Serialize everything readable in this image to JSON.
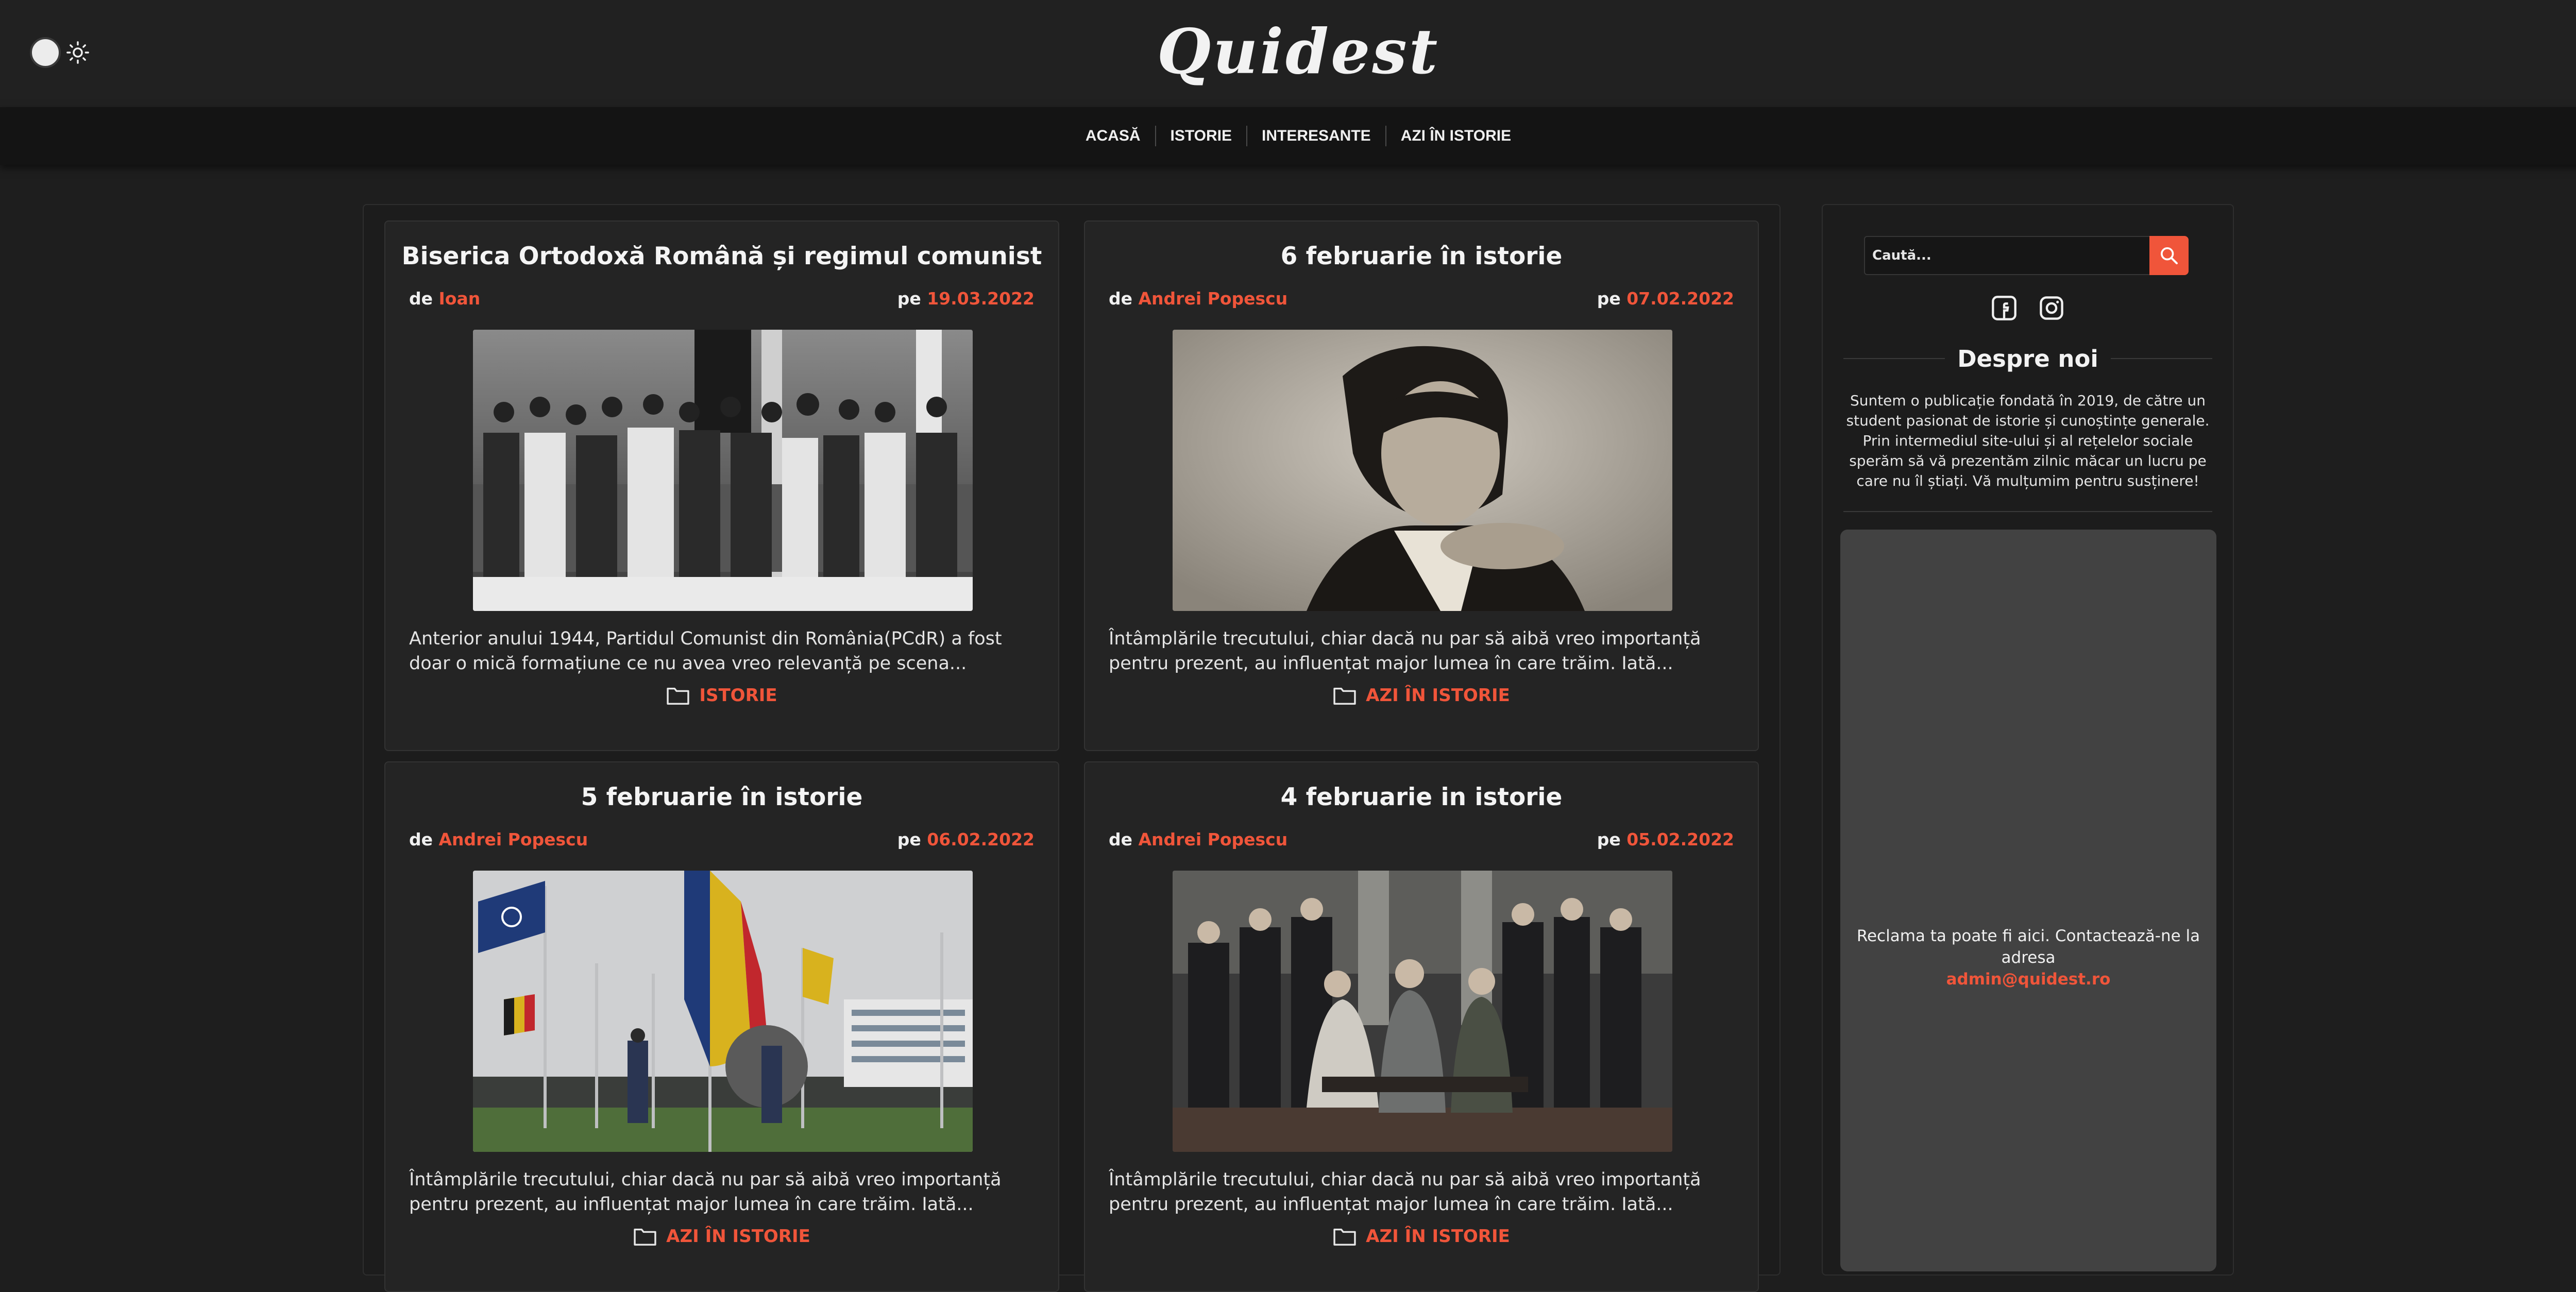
{
  "header": {
    "logo": "Quidest",
    "theme_toggle": {
      "icon": "sun-icon",
      "state": "light"
    }
  },
  "nav": {
    "items": [
      {
        "label": "ACASĂ"
      },
      {
        "label": "ISTORIE"
      },
      {
        "label": "INTERESANTE"
      },
      {
        "label": "AZI ÎN ISTORIE"
      }
    ]
  },
  "posts": [
    {
      "title": "Biserica Ortodoxă Română și regimul comunist",
      "by_label": "de",
      "author": "Ioan",
      "on_label": "pe",
      "date": "19.03.2022",
      "excerpt": "Anterior anului 1944, Partidul Comunist din România(PCdR) a fost doar o mică formațiune ce nu avea vreo relevanță pe scena...",
      "category": "ISTORIE"
    },
    {
      "title": "6 februarie în istorie",
      "by_label": "de",
      "author": "Andrei Popescu",
      "on_label": "pe",
      "date": "07.02.2022",
      "excerpt": "Întâmplările trecutului, chiar dacă nu par să aibă vreo importanță pentru prezent, au influențat major lumea în care trăim. Iată...",
      "category": "AZI ÎN ISTORIE"
    },
    {
      "title": "5 februarie în istorie",
      "by_label": "de",
      "author": "Andrei Popescu",
      "on_label": "pe",
      "date": "06.02.2022",
      "excerpt": "Întâmplările trecutului, chiar dacă nu par să aibă vreo importanță pentru prezent, au influențat major lumea în care trăim. Iată...",
      "category": "AZI ÎN ISTORIE"
    },
    {
      "title": "4 februarie in istorie",
      "by_label": "de",
      "author": "Andrei Popescu",
      "on_label": "pe",
      "date": "05.02.2022",
      "excerpt": "Întâmplările trecutului, chiar dacă nu par să aibă vreo importanță pentru prezent, au influențat major lumea în care trăim. Iată...",
      "category": "AZI ÎN ISTORIE"
    }
  ],
  "sidebar": {
    "search": {
      "placeholder": "Caută..."
    },
    "social": [
      {
        "icon": "facebook-icon"
      },
      {
        "icon": "instagram-icon"
      }
    ],
    "about": {
      "title": "Despre noi",
      "text": "Suntem o publicație fondată în 2019, de către un student pasionat de istorie și cunoștințe generale. Prin intermediul site-ului și al rețelelor sociale sperăm să vă prezentăm zilnic măcar un lucru pe care nu îl știați. Vă mulțumim pentru susținere!"
    },
    "ad": {
      "text": "Reclama ta poate fi aici. Contactează-ne la adresa",
      "email": "admin@quidest.ro"
    }
  },
  "colors": {
    "accent": "#f0553a",
    "background": "#1e1e1e",
    "card": "#242424"
  }
}
